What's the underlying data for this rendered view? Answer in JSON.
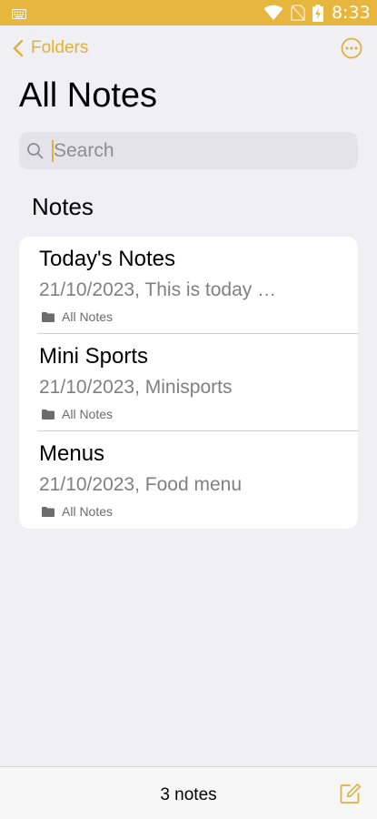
{
  "status_bar": {
    "time": "8:33",
    "icons": [
      "keyboard-icon",
      "wifi-icon",
      "no-sim-icon",
      "battery-charging-icon"
    ],
    "background": "#e6b63e"
  },
  "nav": {
    "back_label": "Folders",
    "back_icon": "chevron-left-icon",
    "more_icon": "more-circle-icon",
    "accent": "#e0b13a"
  },
  "page": {
    "title": "All Notes"
  },
  "search": {
    "placeholder": "Search",
    "value": "",
    "icon": "search-icon"
  },
  "section": {
    "title": "Notes"
  },
  "notes": [
    {
      "title": "Today's Notes",
      "subtitle": "21/10/2023, This is today …",
      "folder": "All Notes"
    },
    {
      "title": "Mini Sports",
      "subtitle": "21/10/2023, Minisports",
      "folder": "All Notes"
    },
    {
      "title": "Menus",
      "subtitle": "21/10/2023, Food menu",
      "folder": "All Notes"
    }
  ],
  "footer": {
    "count_label": "3 notes",
    "compose_icon": "compose-icon"
  }
}
